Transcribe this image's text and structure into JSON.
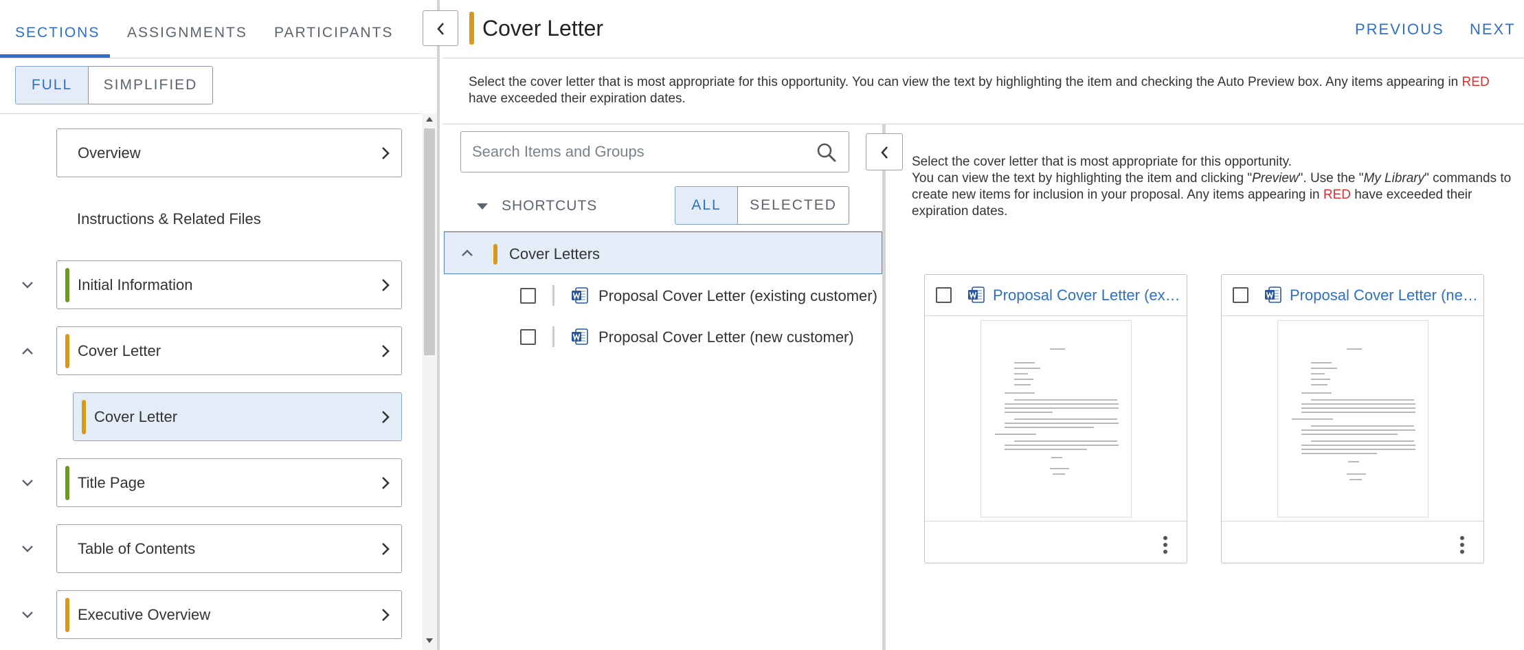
{
  "left_panel": {
    "tabs": [
      {
        "label": "SECTIONS",
        "active": true
      },
      {
        "label": "ASSIGNMENTS",
        "active": false
      },
      {
        "label": "PARTICIPANTS",
        "active": false
      }
    ],
    "view_modes": [
      {
        "label": "FULL",
        "selected": true
      },
      {
        "label": "SIMPLIFIED",
        "selected": false
      }
    ],
    "sections": [
      {
        "label": "Overview",
        "color": "",
        "toggle": ""
      },
      {
        "label": "Instructions & Related Files",
        "link": true
      },
      {
        "label": "Initial Information",
        "color": "#6b9a1e",
        "toggle": "expand"
      },
      {
        "label": "Cover Letter",
        "color": "#d69a18",
        "toggle": "collapse"
      },
      {
        "label": "Cover Letter",
        "color": "#d69a18",
        "child": true,
        "selected": true
      },
      {
        "label": "Title Page",
        "color": "#6b9a1e",
        "toggle": "expand"
      },
      {
        "label": "Table of Contents",
        "color": "",
        "toggle": "expand"
      },
      {
        "label": "Executive Overview",
        "color": "#d69a18",
        "toggle": "expand"
      }
    ]
  },
  "header": {
    "title": "Cover Letter",
    "title_color": "#d69a18",
    "previous": "PREVIOUS",
    "next": "NEXT"
  },
  "instructions": {
    "before_red": "Select the cover letter that is most appropriate for this opportunity. You can view the text by highlighting the item and checking the Auto Preview box. Any items appearing in",
    "red": "RED",
    "after_red": "have exceeded their expiration dates."
  },
  "middle_panel": {
    "search_placeholder": "Search Items and Groups",
    "shortcuts_label": "SHORTCUTS",
    "filter": [
      {
        "label": "ALL",
        "selected": true
      },
      {
        "label": "SELECTED",
        "selected": false
      }
    ],
    "group": {
      "label": "Cover Letters",
      "color": "#d69a18",
      "expanded": true
    },
    "items": [
      {
        "label": "Proposal Cover Letter (existing customer)",
        "checked": false
      },
      {
        "label": "Proposal Cover Letter (new customer)",
        "checked": false
      }
    ]
  },
  "right_panel": {
    "line1": "Select the cover letter that is most appropriate for this opportunity.",
    "p1": "You can view the text by highlighting the item and clicking \"",
    "preview_word": "Preview",
    "p2": "\". Use the \"",
    "library_word": "My Library",
    "p3": "\" commands to create new items for inclusion in your proposal. Any items appearing in",
    "red": "RED",
    "p4": "have exceeded their expiration dates.",
    "cards": [
      {
        "title": "Proposal Cover Letter (existing customer)",
        "icon": "word-doc-icon"
      },
      {
        "title": "Proposal Cover Letter (new customer)",
        "icon": "word-doc-icon"
      }
    ]
  },
  "colors": {
    "accent": "#2e6fc9",
    "alert": "#e03030",
    "word": "#2b579a"
  }
}
